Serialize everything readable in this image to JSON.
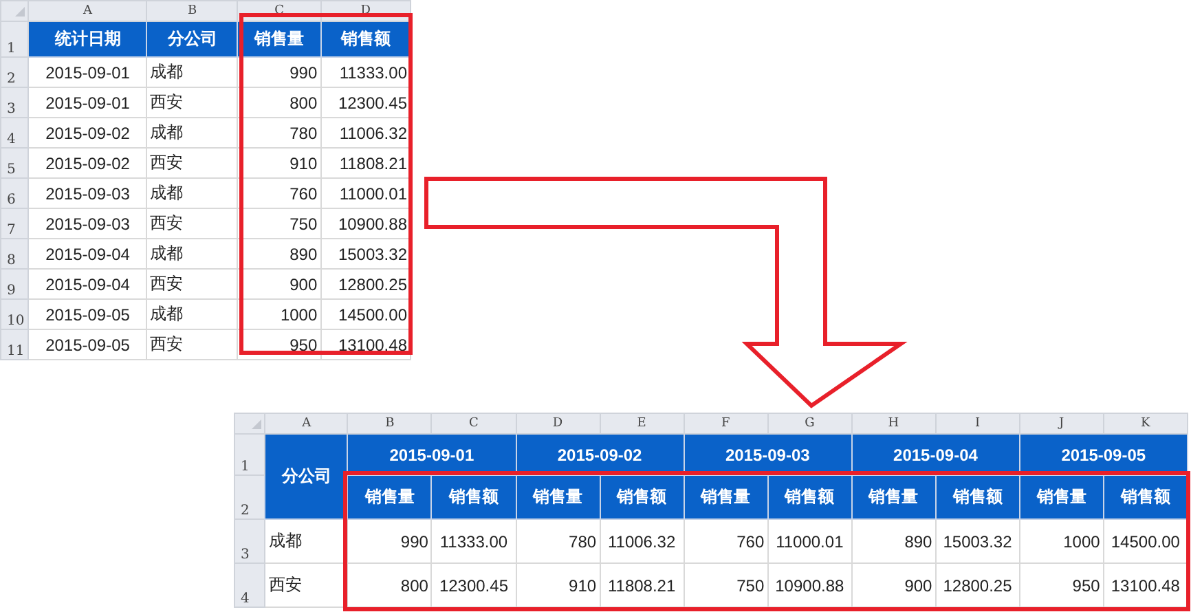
{
  "top_sheet": {
    "column_letters": [
      "A",
      "B",
      "C",
      "D"
    ],
    "row_numbers": [
      "1",
      "2",
      "3",
      "4",
      "5",
      "6",
      "7",
      "8",
      "9",
      "10",
      "11"
    ],
    "header": [
      "统计日期",
      "分公司",
      "销售量",
      "销售额"
    ],
    "rows": [
      [
        "2015-09-01",
        "成都",
        "990",
        "11333.00"
      ],
      [
        "2015-09-01",
        "西安",
        "800",
        "12300.45"
      ],
      [
        "2015-09-02",
        "成都",
        "780",
        "11006.32"
      ],
      [
        "2015-09-02",
        "西安",
        "910",
        "11808.21"
      ],
      [
        "2015-09-03",
        "成都",
        "760",
        "11000.01"
      ],
      [
        "2015-09-03",
        "西安",
        "750",
        "10900.88"
      ],
      [
        "2015-09-04",
        "成都",
        "890",
        "15003.32"
      ],
      [
        "2015-09-04",
        "西安",
        "900",
        "12800.25"
      ],
      [
        "2015-09-05",
        "成都",
        "1000",
        "14500.00"
      ],
      [
        "2015-09-05",
        "西安",
        "950",
        "13100.48"
      ]
    ]
  },
  "bottom_sheet": {
    "column_letters": [
      "A",
      "B",
      "C",
      "D",
      "E",
      "F",
      "G",
      "H",
      "I",
      "J",
      "K"
    ],
    "row_numbers": [
      "1",
      "2",
      "3",
      "4"
    ],
    "corner_header": "分公司",
    "dates": [
      "2015-09-01",
      "2015-09-02",
      "2015-09-03",
      "2015-09-04",
      "2015-09-05"
    ],
    "subheaders": [
      "销售量",
      "销售额",
      "销售量",
      "销售额",
      "销售量",
      "销售额",
      "销售量",
      "销售额",
      "销售量",
      "销售额"
    ],
    "rows": [
      {
        "branch": "成都",
        "cells": [
          "990",
          "11333.00",
          "780",
          "11006.32",
          "760",
          "11000.01",
          "890",
          "15003.32",
          "1000",
          "14500.00"
        ]
      },
      {
        "branch": "西安",
        "cells": [
          "800",
          "12300.45",
          "910",
          "11808.21",
          "750",
          "10900.88",
          "900",
          "12800.25",
          "950",
          "13100.48"
        ]
      }
    ]
  }
}
